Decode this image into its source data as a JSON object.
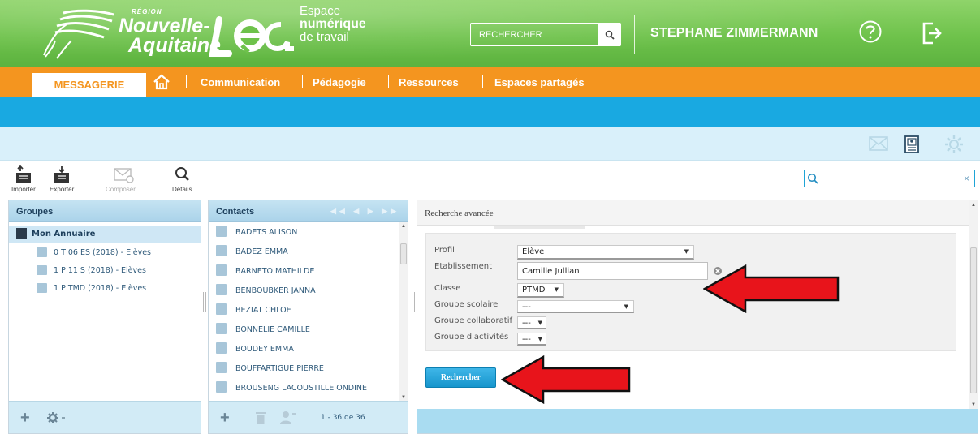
{
  "header": {
    "region_small": "RÉGION",
    "region_line1": "Nouvelle-",
    "region_line2": "Aquitaine",
    "espace_line1": "Espace",
    "espace_line2": "numérique",
    "espace_line3": "de travail",
    "search_label": "RECHERCHER",
    "username": "STEPHANE ZIMMERMANN",
    "icons": [
      "help-icon",
      "logout-icon",
      "search-icon"
    ]
  },
  "nav": {
    "active_tab": "MESSAGERIE",
    "items": [
      "Communication",
      "Pédagogie",
      "Ressources",
      "Espaces partagés"
    ]
  },
  "toolbar": {
    "importer": "Importer",
    "exporter": "Exporter",
    "composer": "Composer...",
    "details": "Détails",
    "filter_value": ""
  },
  "groups": {
    "title": "Groupes",
    "root": "Mon Annuaire",
    "items": [
      "0 T 06 ES (2018) - Elèves",
      "1 P 11 S (2018) - Elèves",
      "1 P TMD (2018) - Elèves"
    ]
  },
  "contacts": {
    "title": "Contacts",
    "items": [
      "BADETS ALISON",
      "BADEZ EMMA",
      "BARNETO MATHILDE",
      "BENBOUBKER JANNA",
      "BEZIAT CHLOE",
      "BONNELIE CAMILLE",
      "BOUDEY EMMA",
      "BOUFFARTIGUE PIERRE",
      "BROUSENG LACOUSTILLE ONDINE"
    ],
    "pager": "1 - 36 de 36"
  },
  "search": {
    "title": "Recherche avancée",
    "profil_label": "Profil",
    "profil_value": "Elève",
    "etab_label": "Etablissement",
    "etab_value": "Camille Jullian",
    "classe_label": "Classe",
    "classe_value": "PTMD",
    "groupe_scolaire_label": "Groupe scolaire",
    "groupe_scolaire_value": "---",
    "groupe_collab_label": "Groupe collaboratif",
    "groupe_collab_value": "---",
    "groupe_activites_label": "Groupe d'activités",
    "groupe_activites_value": "---",
    "submit_label": "Rechercher"
  },
  "colors": {
    "header_green": "#6ec24b",
    "nav_orange": "#f4951f",
    "band_blue": "#19a9e1",
    "arrow_red": "#e8141b"
  }
}
